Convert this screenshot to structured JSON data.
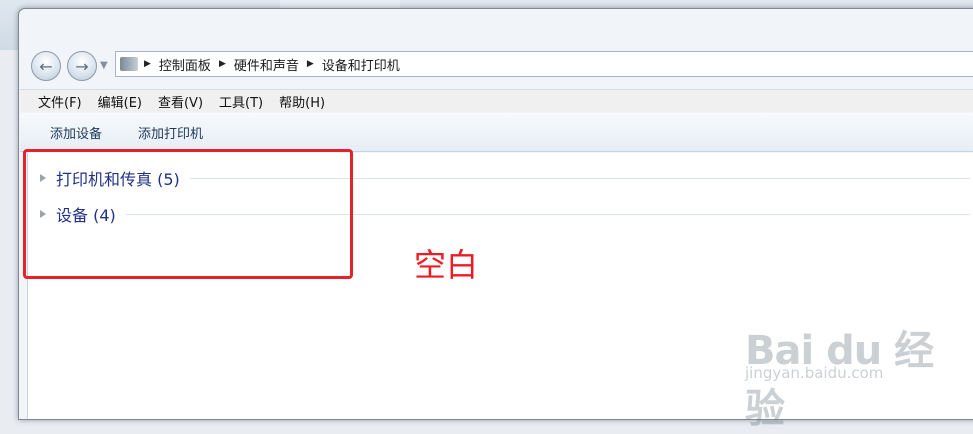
{
  "address": {
    "crumbs": [
      "控制面板",
      "硬件和声音",
      "设备和打印机"
    ]
  },
  "menu": {
    "items": [
      "文件(F)",
      "编辑(E)",
      "查看(V)",
      "工具(T)",
      "帮助(H)"
    ]
  },
  "toolbar": {
    "add_device": "添加设备",
    "add_printer": "添加打印机"
  },
  "groups": {
    "printers": "打印机和传真 (5)",
    "devices": "设备 (4)"
  },
  "annotation": {
    "text": "空白"
  },
  "watermark": {
    "brand": "Bai du 经验",
    "url": "jingyan.baidu.com"
  },
  "colors": {
    "highlight": "#e5212a",
    "annotation": "#ef1b24",
    "group_text": "#1e3287"
  }
}
